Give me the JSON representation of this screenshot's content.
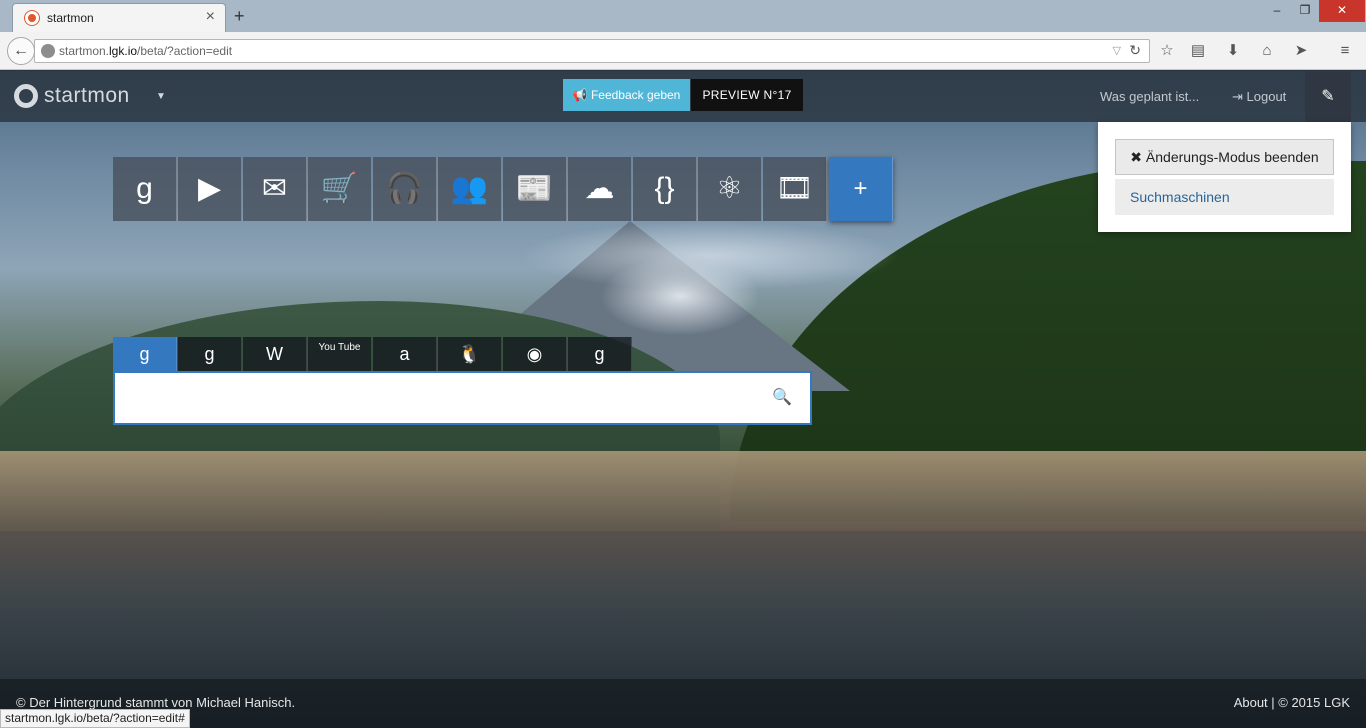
{
  "browser": {
    "tab_title": "startmon",
    "url_host_prefix": "startmon.",
    "url_host_bold": "lgk.io",
    "url_path": "/beta/?action=edit",
    "status_url": "startmon.lgk.io/beta/?action=edit#"
  },
  "nav": {
    "logo": "startmon",
    "feedback": "Feedback geben",
    "preview": "PREVIEW N°17",
    "planned": "Was geplant ist...",
    "logout": "Logout"
  },
  "menu": {
    "exit_edit": "Änderungs-Modus beenden",
    "search_engines": "Suchmaschinen"
  },
  "bookmarks": [
    {
      "icon": "google-icon",
      "glyph": "g"
    },
    {
      "icon": "play-icon",
      "glyph": "▶"
    },
    {
      "icon": "mail-icon",
      "glyph": "✉"
    },
    {
      "icon": "cart-icon",
      "glyph": "🛒"
    },
    {
      "icon": "headphones-icon",
      "glyph": "🎧"
    },
    {
      "icon": "users-icon",
      "glyph": "👥"
    },
    {
      "icon": "news-icon",
      "glyph": "📰"
    },
    {
      "icon": "cloud-icon",
      "glyph": "☁"
    },
    {
      "icon": "code-braces-icon",
      "glyph": "{}"
    },
    {
      "icon": "atom-icon",
      "glyph": "⚛"
    },
    {
      "icon": "film-icon",
      "glyph": "🎞"
    },
    {
      "icon": "add-icon",
      "glyph": "+"
    }
  ],
  "engines": [
    {
      "icon": "google-web-icon",
      "glyph": "g",
      "active": true
    },
    {
      "icon": "google-translate-icon",
      "glyph": "g"
    },
    {
      "icon": "wikipedia-icon",
      "glyph": "W"
    },
    {
      "icon": "youtube-icon",
      "glyph": "You Tube"
    },
    {
      "icon": "amazon-icon",
      "glyph": "a"
    },
    {
      "icon": "linux-icon",
      "glyph": "🐧"
    },
    {
      "icon": "duckduckgo-icon",
      "glyph": "◉"
    },
    {
      "icon": "google-search-icon",
      "glyph": "g"
    }
  ],
  "search": {
    "placeholder": ""
  },
  "footer": {
    "credit": "Der Hintergrund stammt von Michael Hanisch.",
    "about": "About | © 2015 LGK"
  },
  "colors": {
    "accent": "#3478c0",
    "feedback": "#4fb6d8",
    "preview_bg": "#111111"
  }
}
